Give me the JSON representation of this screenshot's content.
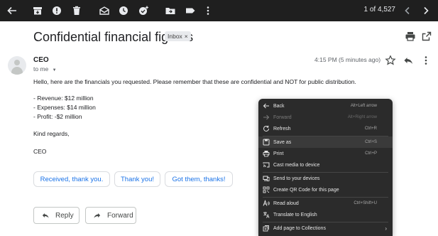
{
  "toolbar": {
    "counter": "1 of 4,527",
    "icons": [
      "back-arrow-icon",
      "archive-icon",
      "report-spam-icon",
      "delete-icon",
      "mark-unread-icon",
      "snooze-icon",
      "add-to-tasks-icon",
      "move-to-icon",
      "label-icon",
      "more-vert-icon",
      "prev-icon",
      "next-icon"
    ]
  },
  "email": {
    "subject": "Confidential financial figures",
    "label_chip": "Inbox",
    "sender": "CEO",
    "to": "to me",
    "time": "4:15 PM (5 minutes ago)",
    "body": [
      "Hello, here are the financials you requested. Please remember that these are confidential and NOT for public distribution.",
      "- Revenue: $12 million",
      "- Expenses: $14 million",
      "- Profit: -$2 million",
      "Kind regards,",
      "CEO"
    ]
  },
  "smart_replies": [
    "Received, thank you.",
    "Thank you!",
    "Got them, thanks!"
  ],
  "actions": {
    "reply": "Reply",
    "forward": "Forward"
  },
  "context_menu": {
    "back": {
      "label": "Back",
      "shortcut": "Alt+Left arrow"
    },
    "forward": {
      "label": "Forward",
      "shortcut": "Alt+Right arrow"
    },
    "refresh": {
      "label": "Refresh",
      "shortcut": "Ctrl+R"
    },
    "save_as": {
      "label": "Save as",
      "shortcut": "Ctrl+S"
    },
    "print": {
      "label": "Print",
      "shortcut": "Ctrl+P"
    },
    "cast": {
      "label": "Cast media to device"
    },
    "send_devices": {
      "label": "Send to your devices"
    },
    "qr_code": {
      "label": "Create QR Code for this page"
    },
    "read_aloud": {
      "label": "Read aloud",
      "shortcut": "Ctrl+Shift+U"
    },
    "translate": {
      "label": "Translate to English"
    },
    "collections": {
      "label": "Add page to Collections"
    }
  },
  "colors": {
    "toolbar_bg": "#1f1f1f",
    "menu_bg": "#2b2b2b",
    "link_blue": "#1a73e8"
  }
}
